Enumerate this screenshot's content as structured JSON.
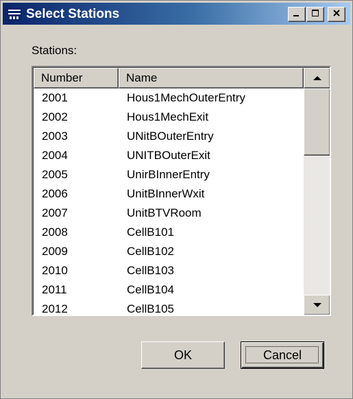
{
  "window": {
    "title": "Select Stations",
    "icon": "app-window-icon",
    "controls": {
      "minimize": "minimize-icon",
      "maximize": "maximize-icon",
      "close": "close-icon"
    }
  },
  "stations_label": "Stations:",
  "list": {
    "columns": [
      "Number",
      "Name"
    ],
    "rows": [
      {
        "number": "2001",
        "name": "Hous1MechOuterEntry"
      },
      {
        "number": "2002",
        "name": "Hous1MechExit"
      },
      {
        "number": "2003",
        "name": "UNitBOuterEntry"
      },
      {
        "number": "2004",
        "name": "UNITBOuterExit"
      },
      {
        "number": "2005",
        "name": "UnirBInnerEntry"
      },
      {
        "number": "2006",
        "name": "UnitBInnerWxit"
      },
      {
        "number": "2007",
        "name": "UnitBTVRoom"
      },
      {
        "number": "2008",
        "name": "CellB101"
      },
      {
        "number": "2009",
        "name": "CellB102"
      },
      {
        "number": "2010",
        "name": "CellB103"
      },
      {
        "number": "2011",
        "name": "CellB104"
      },
      {
        "number": "2012",
        "name": "CellB105"
      }
    ],
    "scrollbar": {
      "up": "arrow-up-icon",
      "down": "arrow-down-icon"
    }
  },
  "buttons": {
    "ok": "OK",
    "cancel": "Cancel"
  },
  "colors": {
    "title_start": "#0a246a",
    "title_end": "#a6caf0",
    "face": "#d4d0c8"
  }
}
